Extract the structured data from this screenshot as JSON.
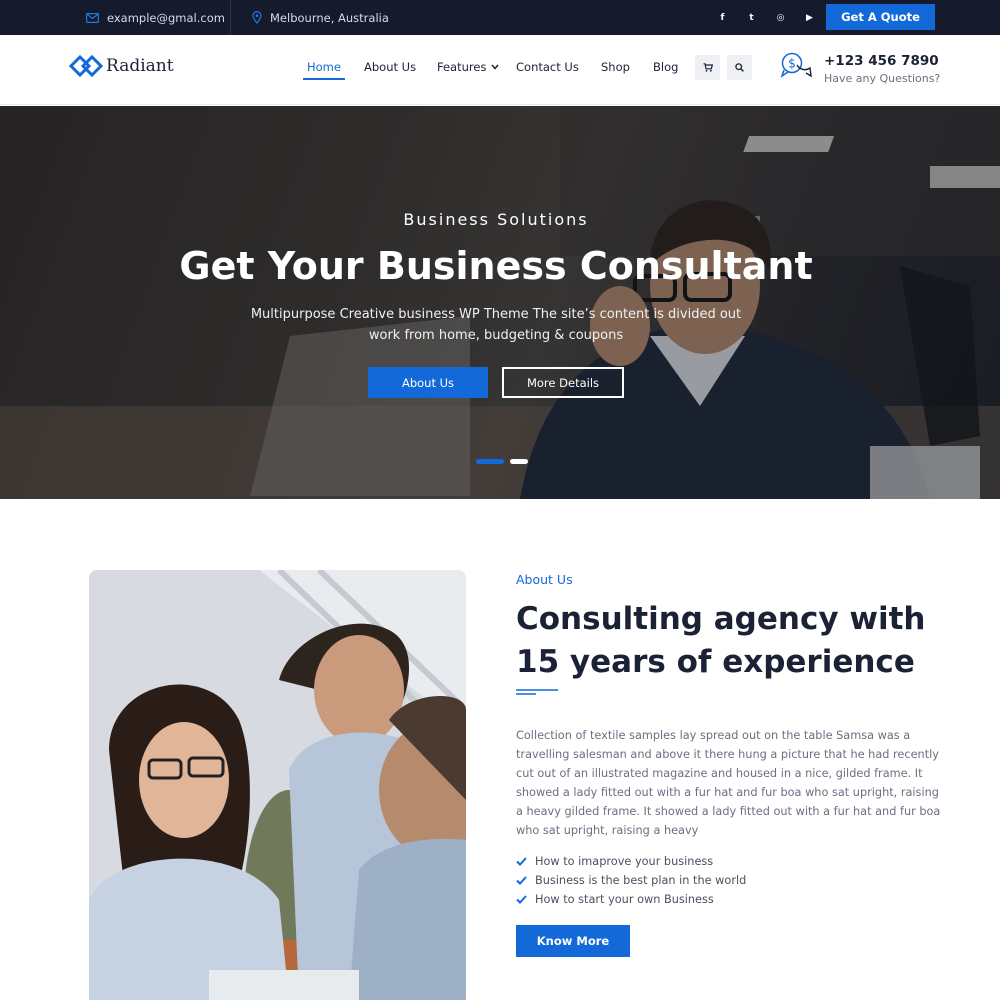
{
  "topbar": {
    "email": "example@gmal.com",
    "email_icon": "envelope-icon",
    "location": "Melbourne, Australia",
    "location_icon": "map-pin-icon",
    "socials": [
      "f",
      "t",
      "◎",
      "▶"
    ],
    "social_icons": [
      "facebook-icon",
      "twitter-icon",
      "instagram-icon",
      "youtube-icon"
    ],
    "quote_label": "Get A Quote"
  },
  "header": {
    "logo_text": "Radiant",
    "nav": [
      {
        "label": "Home",
        "active": true
      },
      {
        "label": "About Us"
      },
      {
        "label": "Features"
      },
      {
        "label": "Contact Us"
      },
      {
        "label": "Shop"
      },
      {
        "label": "Blog"
      }
    ],
    "phone": "+123 456 7890",
    "phone_sub": "Have any Questions?"
  },
  "hero": {
    "eyebrow": "Business Solutions",
    "title": "Get Your Business Consultant",
    "text": "Multipurpose Creative business WP Theme The site’s content is divided out work from home, budgeting & coupons",
    "btn_primary": "About Us",
    "btn_secondary": "More Details"
  },
  "about": {
    "eyebrow": "About Us",
    "title": "Consulting agency with 15 years of experience",
    "text": "Collection of textile samples lay spread out on the table Samsa was a travelling salesman and above it there hung a picture that he had recently cut out of an illustrated magazine and housed in a nice, gilded frame. It showed a lady fitted out with a fur hat and fur boa who sat upright, raising a heavy gilded frame. It showed a lady fitted out with a fur hat and fur boa who sat upright, raising a heavy",
    "checklist": [
      "How to imaprove your business",
      "Business is the best plan in the world",
      "How to start your own Business"
    ],
    "button": "Know More"
  },
  "colors": {
    "accent": "#1469d9",
    "dark": "#151a2c",
    "heading": "#1b2236"
  }
}
